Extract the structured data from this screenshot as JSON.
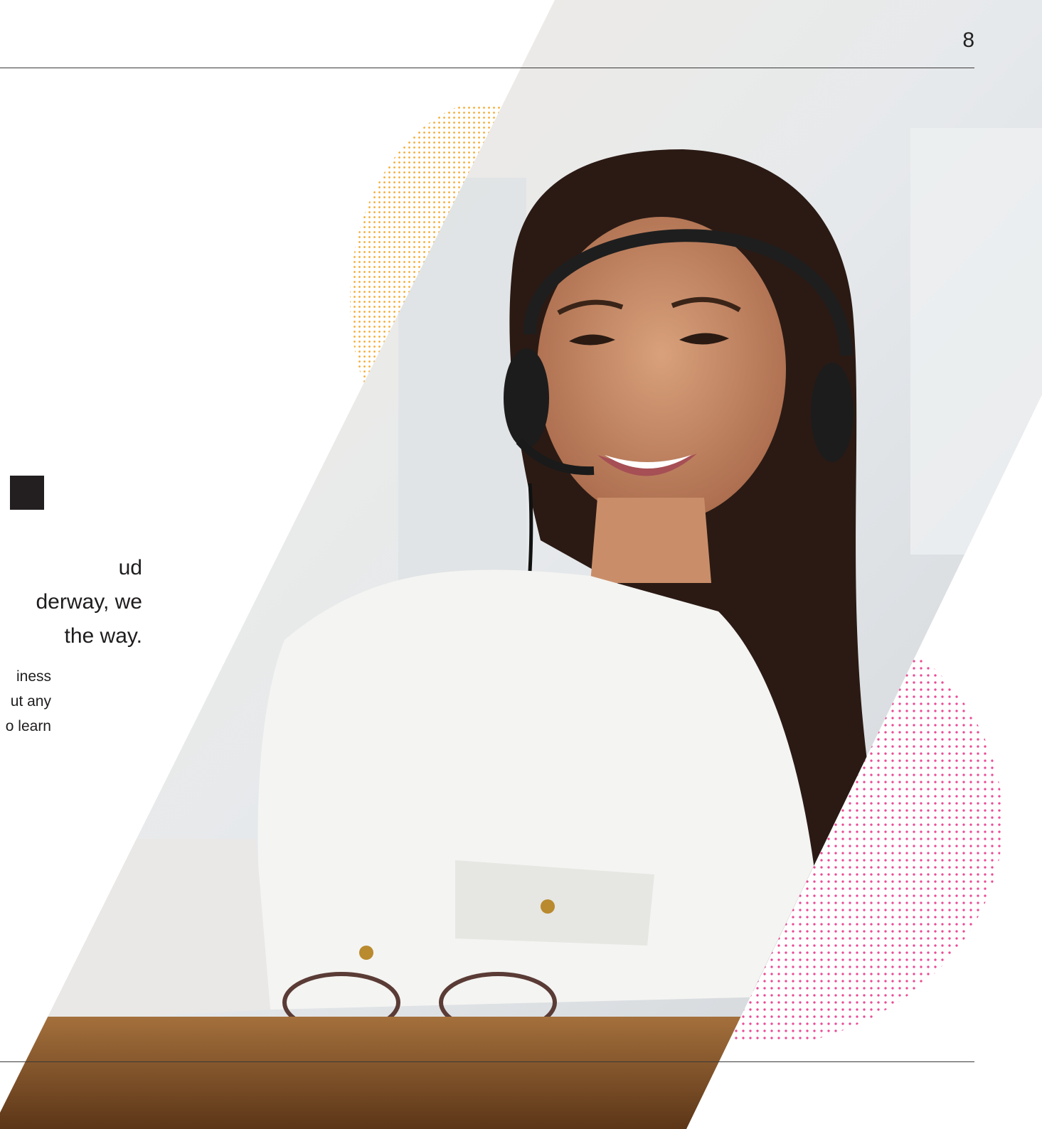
{
  "page": {
    "number": "8"
  },
  "heading": {
    "lines": [
      "ud",
      "derway, we",
      "the way."
    ]
  },
  "body": {
    "lines": [
      "iness",
      "ut any",
      "o learn"
    ]
  },
  "colors": {
    "orange_dots": "#f5a623",
    "pink_dots": "#e8388a",
    "square": "#231f20",
    "rule": "#3a3a3a"
  },
  "photo": {
    "subject": "smiling woman wearing a headset at a desk"
  }
}
